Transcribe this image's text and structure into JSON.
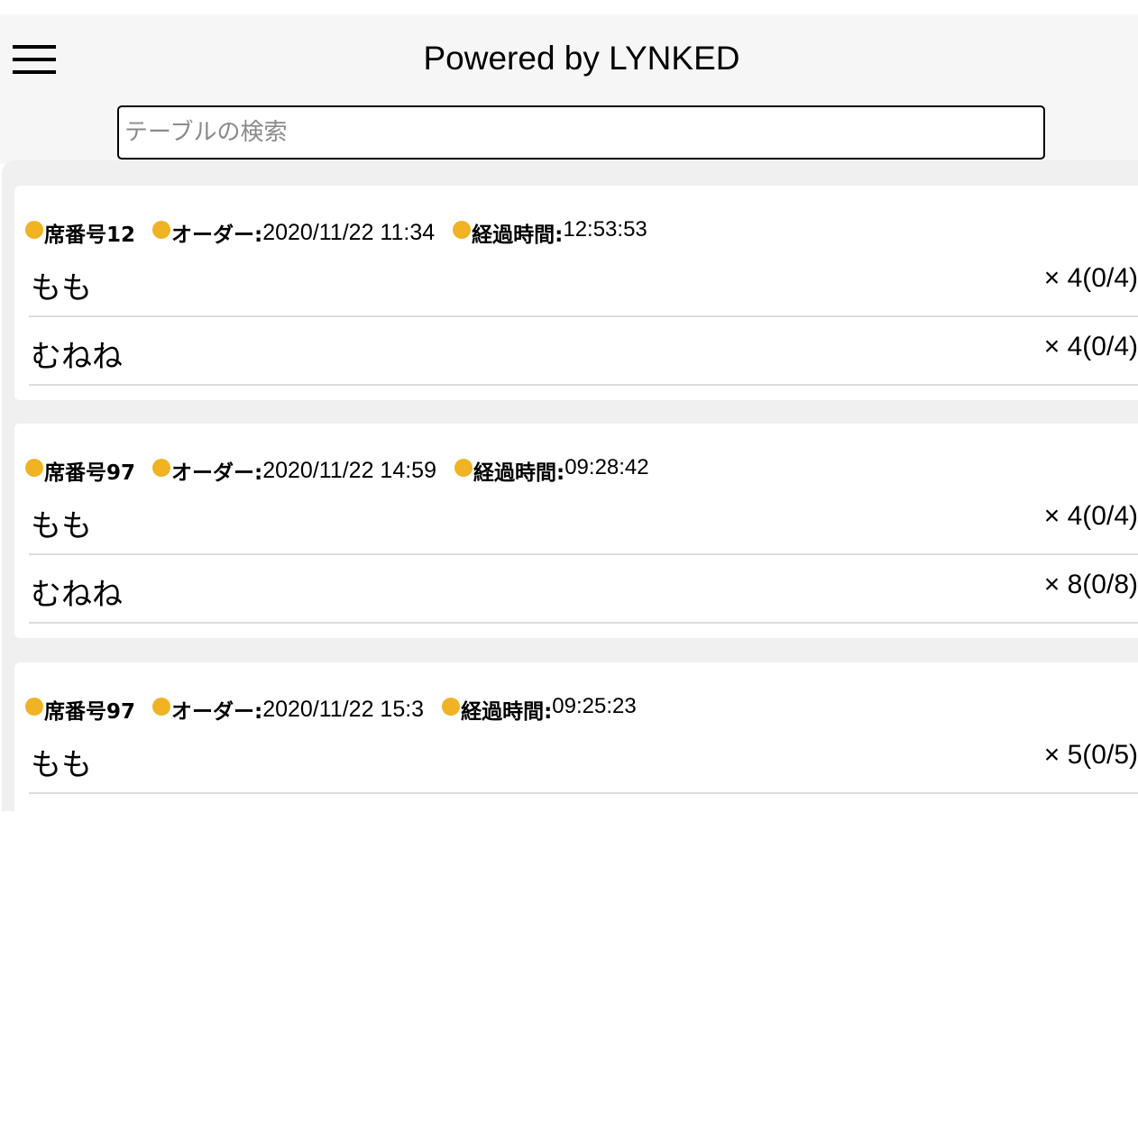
{
  "header": {
    "title": "Powered by LYNKED",
    "menu_icon": "hamburger-menu-icon"
  },
  "search": {
    "placeholder": "テーブルの検索",
    "value": ""
  },
  "colors": {
    "status_dot": "#f0b323",
    "header_bg": "#f6f6f6",
    "list_bg": "#f0f0f0"
  },
  "orders": [
    {
      "seat_label": "席番号12",
      "order_label": "オーダー:",
      "order_time": "2020/11/22 11:34",
      "elapsed_label": "経過時間:",
      "elapsed_time": "12:53:53",
      "items": [
        {
          "name": "もも",
          "qty": "× 4(0/4)"
        },
        {
          "name": "むねね",
          "qty": "× 4(0/4)"
        }
      ]
    },
    {
      "seat_label": "席番号97",
      "order_label": "オーダー:",
      "order_time": "2020/11/22 14:59",
      "elapsed_label": "経過時間:",
      "elapsed_time": "09:28:42",
      "items": [
        {
          "name": "もも",
          "qty": "× 4(0/4)"
        },
        {
          "name": "むねね",
          "qty": "× 8(0/8)"
        }
      ]
    },
    {
      "seat_label": "席番号97",
      "order_label": "オーダー:",
      "order_time": "2020/11/22 15:3",
      "elapsed_label": "経過時間:",
      "elapsed_time": "09:25:23",
      "items": [
        {
          "name": "もも",
          "qty": "× 5(0/5)"
        }
      ]
    }
  ]
}
